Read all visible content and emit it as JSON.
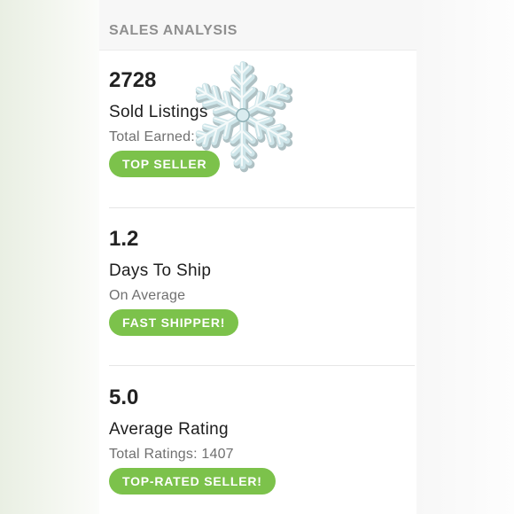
{
  "header": {
    "title": "SALES ANALYSIS"
  },
  "stats": [
    {
      "value": "2728",
      "label": "Sold Listings",
      "sublabel": "Total Earned:",
      "badge": "TOP SELLER"
    },
    {
      "value": "1.2",
      "label": "Days To Ship",
      "sublabel": "On Average",
      "badge": "FAST SHIPPER!"
    },
    {
      "value": "5.0",
      "label": "Average Rating",
      "sublabel": "Total Ratings: 1407",
      "badge": "TOP-RATED SELLER!"
    }
  ],
  "colors": {
    "badge_green": "#7cc24b",
    "header_text": "#8f8f8f",
    "snowflake": "#cfe6ea"
  },
  "icons": {
    "overlay": "snowflake-icon"
  }
}
